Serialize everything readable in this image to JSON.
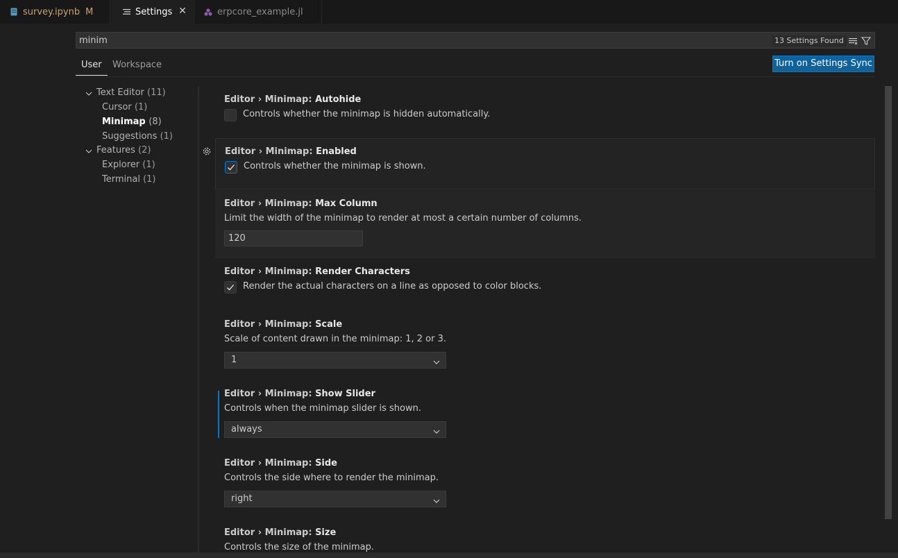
{
  "tabs": [
    {
      "label": "survey.ipynb",
      "modified": "M",
      "icon": "notebook-icon"
    },
    {
      "label": "Settings",
      "icon": "settings-editor-icon"
    },
    {
      "label": "erpcore_example.jl",
      "icon": "julia-icon"
    }
  ],
  "search": {
    "value": "minim",
    "found": "13 Settings Found"
  },
  "scopes": {
    "user": "User",
    "workspace": "Workspace"
  },
  "sync_button": "Turn on Settings Sync",
  "toc": [
    {
      "label": "Text Editor",
      "count": "(11)"
    },
    {
      "label": "Cursor",
      "count": "(1)"
    },
    {
      "label": "Minimap",
      "count": "(8)"
    },
    {
      "label": "Suggestions",
      "count": "(1)"
    },
    {
      "label": "Features",
      "count": "(2)"
    },
    {
      "label": "Explorer",
      "count": "(1)"
    },
    {
      "label": "Terminal",
      "count": "(1)"
    }
  ],
  "settings": [
    {
      "category": "Editor › Minimap: ",
      "name": "Autohide",
      "description": "Controls whether the minimap is hidden automatically.",
      "checked": false
    },
    {
      "category": "Editor › Minimap: ",
      "name": "Enabled",
      "description": "Controls whether the minimap is shown.",
      "checked": true
    },
    {
      "category": "Editor › Minimap: ",
      "name": "Max Column",
      "description": "Limit the width of the minimap to render at most a certain number of columns.",
      "value": "120"
    },
    {
      "category": "Editor › Minimap: ",
      "name": "Render Characters",
      "description": "Render the actual characters on a line as opposed to color blocks.",
      "checked": true
    },
    {
      "category": "Editor › Minimap: ",
      "name": "Scale",
      "description": "Scale of content drawn in the minimap: 1, 2 or 3.",
      "value": "1"
    },
    {
      "category": "Editor › Minimap: ",
      "name": "Show Slider",
      "description": "Controls when the minimap slider is shown.",
      "value": "always"
    },
    {
      "category": "Editor › Minimap: ",
      "name": "Side",
      "description": "Controls the side where to render the minimap.",
      "value": "right"
    },
    {
      "category": "Editor › Minimap: ",
      "name": "Size",
      "description": "Controls the size of the minimap."
    }
  ],
  "colors": {
    "accent": "#0078d4",
    "button": "#0e639c",
    "modified": "#c5a374"
  }
}
